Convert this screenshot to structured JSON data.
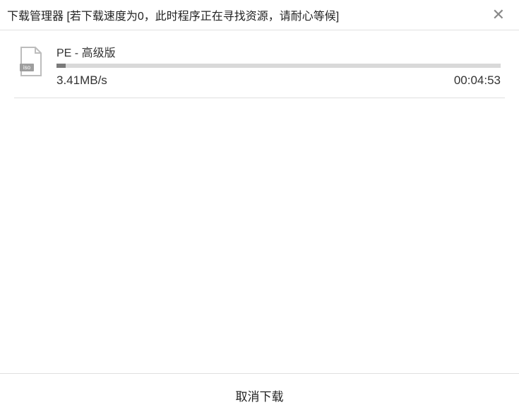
{
  "titlebar": {
    "title": "下载管理器 [若下载速度为0，此时程序正在寻找资源，请耐心等候]"
  },
  "download": {
    "filename": "PE - 高级版",
    "file_ext_label": "iso",
    "progress_percent": 2,
    "speed": "3.41MB/s",
    "remaining": "00:04:53"
  },
  "footer": {
    "cancel_label": "取消下载"
  }
}
